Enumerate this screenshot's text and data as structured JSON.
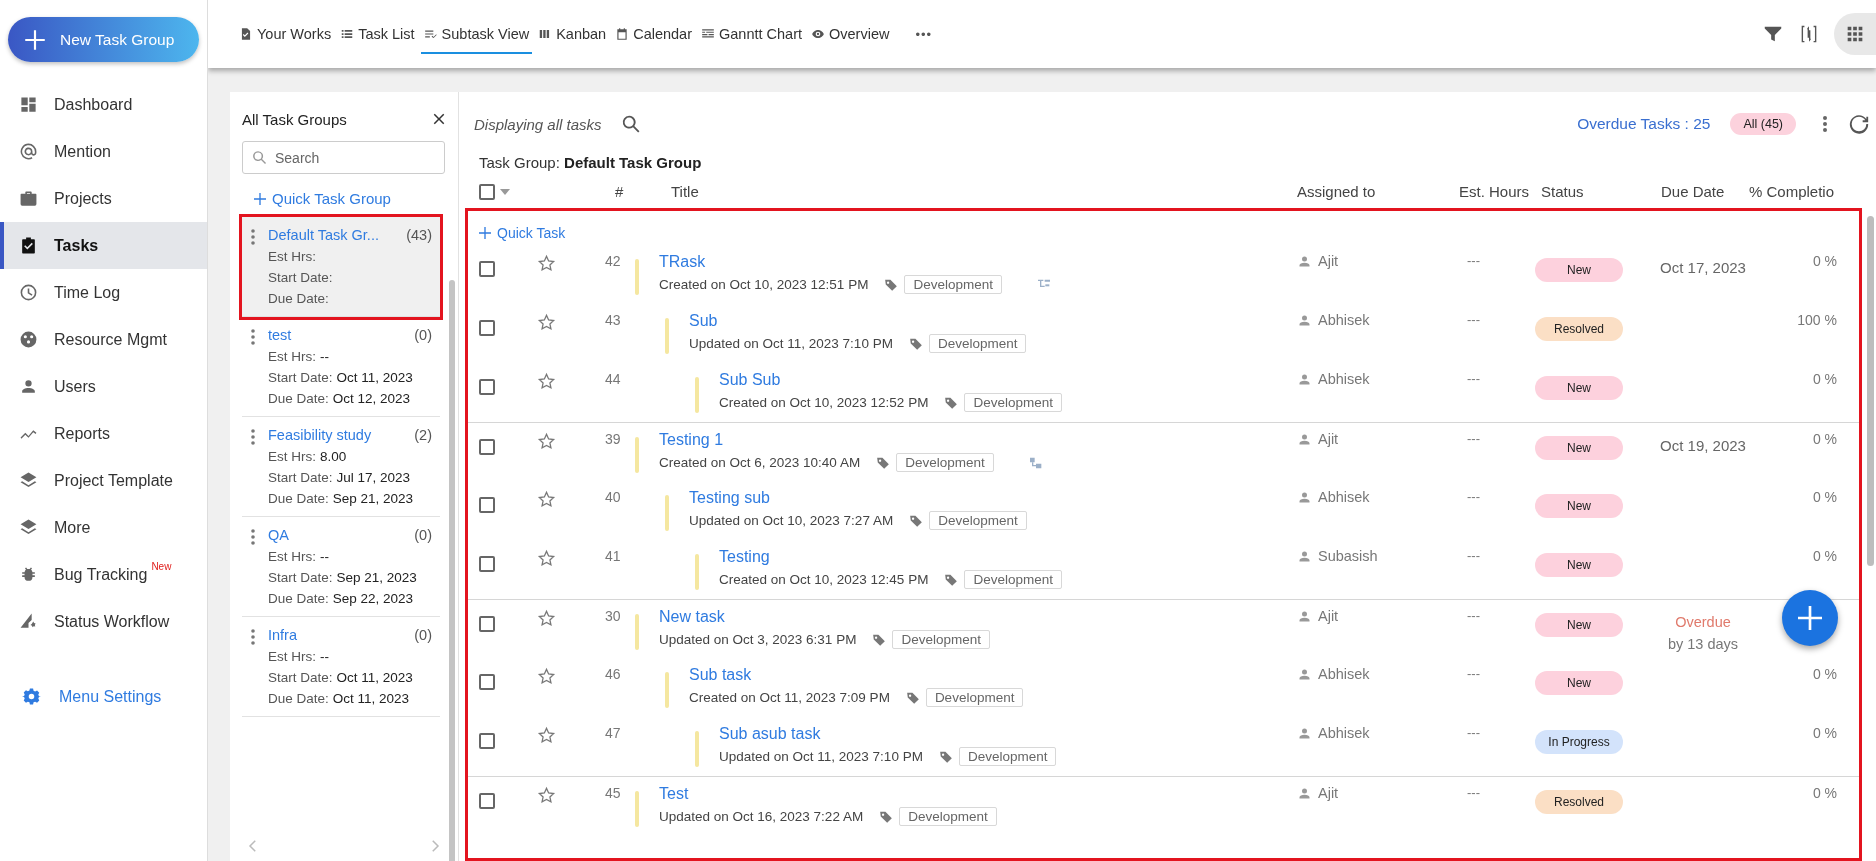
{
  "new_group_button": {
    "label": "New Task Group"
  },
  "nav": [
    {
      "label": "Dashboard",
      "kind": "dashboard",
      "selected": false
    },
    {
      "label": "Mention",
      "kind": "mention",
      "selected": false
    },
    {
      "label": "Projects",
      "kind": "projects",
      "selected": false
    },
    {
      "label": "Tasks",
      "kind": "tasks",
      "selected": true
    },
    {
      "label": "Time Log",
      "kind": "timelog",
      "selected": false
    },
    {
      "label": "Resource Mgmt",
      "kind": "resource",
      "selected": false
    },
    {
      "label": "Users",
      "kind": "users",
      "selected": false
    },
    {
      "label": "Reports",
      "kind": "reports",
      "selected": false
    },
    {
      "label": "Project Template",
      "kind": "template",
      "selected": false
    },
    {
      "label": "More",
      "kind": "more",
      "selected": false
    },
    {
      "label": "Bug Tracking",
      "kind": "bug",
      "selected": false,
      "badge": "New"
    },
    {
      "label": "Status Workflow",
      "kind": "workflow",
      "selected": false
    }
  ],
  "menu_settings": {
    "label": "Menu Settings"
  },
  "tabs": [
    {
      "label": "Your Works",
      "kind": "works",
      "selected": false
    },
    {
      "label": "Task List",
      "kind": "list",
      "selected": false
    },
    {
      "label": "Subtask View",
      "kind": "subtask",
      "selected": true
    },
    {
      "label": "Kanban",
      "kind": "kanban",
      "selected": false
    },
    {
      "label": "Calendar",
      "kind": "calendar",
      "selected": false
    },
    {
      "label": "Ganntt Chart",
      "kind": "gantt",
      "selected": false
    },
    {
      "label": "Overview",
      "kind": "overview",
      "selected": false
    }
  ],
  "more_tabs": "•••",
  "group_panel": {
    "title": "All Task Groups",
    "search_placeholder": "Search",
    "quick_group": "Quick Task Group",
    "groups": [
      {
        "name": "Default Task Gr...",
        "count": "(43)",
        "selected": true,
        "highlighted": true,
        "fields": [
          {
            "label": "Est Hrs:"
          },
          {
            "label": "Start Date:"
          },
          {
            "label": "Due Date:"
          }
        ]
      },
      {
        "name": "test",
        "count": "(0)",
        "selected": false,
        "highlighted": false,
        "fields": [
          {
            "label": "Est Hrs:",
            "value": "--"
          },
          {
            "label": "Start Date:",
            "value": "Oct 11, 2023"
          },
          {
            "label": "Due Date:",
            "value": "Oct 12, 2023"
          }
        ]
      },
      {
        "name": "Feasibility study",
        "count": "(2)",
        "selected": false,
        "highlighted": false,
        "fields": [
          {
            "label": "Est Hrs:",
            "value": "8.00"
          },
          {
            "label": "Start Date:",
            "value": "Jul 17, 2023"
          },
          {
            "label": "Due Date:",
            "value": "Sep 21, 2023"
          }
        ]
      },
      {
        "name": "QA",
        "count": "(0)",
        "selected": false,
        "highlighted": false,
        "fields": [
          {
            "label": "Est Hrs:",
            "value": "--"
          },
          {
            "label": "Start Date:",
            "value": "Sep 21, 2023"
          },
          {
            "label": "Due Date:",
            "value": "Sep 22, 2023"
          }
        ]
      },
      {
        "name": "Infra",
        "count": "(0)",
        "selected": false,
        "highlighted": false,
        "fields": [
          {
            "label": "Est Hrs:",
            "value": "--"
          },
          {
            "label": "Start Date:",
            "value": "Oct 11, 2023"
          },
          {
            "label": "Due Date:",
            "value": "Oct 11, 2023"
          }
        ]
      }
    ]
  },
  "main": {
    "display_label": "Displaying all tasks",
    "overdue_link": "Overdue Tasks : 25",
    "filter_chip": "All (45)",
    "group_label": "Task Group:",
    "group_name": "Default Task Group",
    "select_all": {
      "checked": false
    },
    "columns": [
      "#",
      "Title",
      "Assigned to",
      "Est. Hours",
      "Status",
      "Due Date",
      "% Completio"
    ],
    "highlighted": true,
    "quick_task": "Quick Task",
    "tasks": [
      {
        "number": "42",
        "title": "TRask",
        "meta": "Created on Oct 10, 2023 12:51 PM",
        "tag": "Development",
        "link_icon": {
          "kind": "branch"
        },
        "assignee": "Ajit",
        "est_hours": "---",
        "status": {
          "label": "New",
          "color": "#fdd1dd"
        },
        "due_date": "Oct 17, 2023",
        "completion": "0 %",
        "checked": false,
        "starred": false,
        "children": [
          {
            "number": "43",
            "title": "Sub",
            "meta": "Updated on Oct 11, 2023 7:10 PM",
            "tag": "Development",
            "assignee": "Abhisek",
            "est_hours": "---",
            "status": {
              "label": "Resolved",
              "color": "#fbdfc5"
            },
            "completion": "100 %",
            "checked": false,
            "starred": false,
            "children": [
              {
                "number": "44",
                "title": "Sub Sub",
                "meta": "Created on Oct 10, 2023 12:52 PM",
                "tag": "Development",
                "assignee": "Abhisek",
                "est_hours": "---",
                "status": {
                  "label": "New",
                  "color": "#fdd1dd"
                },
                "completion": "0 %",
                "checked": false,
                "starred": false
              }
            ]
          }
        ]
      },
      {
        "number": "39",
        "title": "Testing 1",
        "meta": "Created on Oct 6, 2023 10:40 AM",
        "tag": "Development",
        "link_icon": {
          "kind": "steps"
        },
        "assignee": "Ajit",
        "est_hours": "---",
        "status": {
          "label": "New",
          "color": "#fdd1dd"
        },
        "due_date": "Oct 19, 2023",
        "completion": "0 %",
        "checked": false,
        "starred": false,
        "children": [
          {
            "number": "40",
            "title": "Testing sub",
            "meta": "Updated on Oct 10, 2023 7:27 AM",
            "tag": "Development",
            "assignee": "Abhisek",
            "est_hours": "---",
            "status": {
              "label": "New",
              "color": "#fdd1dd"
            },
            "completion": "0 %",
            "checked": false,
            "starred": false,
            "children": [
              {
                "number": "41",
                "title": "Testing",
                "meta": "Created on Oct 10, 2023 12:45 PM",
                "tag": "Development",
                "assignee": "Subasish",
                "est_hours": "---",
                "status": {
                  "label": "New",
                  "color": "#fdd1dd"
                },
                "completion": "0 %",
                "checked": false,
                "starred": false
              }
            ]
          }
        ]
      },
      {
        "number": "30",
        "title": "New task",
        "meta": "Updated on Oct 3, 2023 6:31 PM",
        "tag": "Development",
        "assignee": "Ajit",
        "est_hours": "---",
        "status": {
          "label": "New",
          "color": "#fdd1dd"
        },
        "overdue": {
          "label": "Overdue",
          "note": "by 13 days"
        },
        "checked": false,
        "starred": false,
        "children": [
          {
            "number": "46",
            "title": "Sub task",
            "meta": "Created on Oct 11, 2023 7:09 PM",
            "tag": "Development",
            "assignee": "Abhisek",
            "est_hours": "---",
            "status": {
              "label": "New",
              "color": "#fdd1dd"
            },
            "completion": "0 %",
            "checked": false,
            "starred": false,
            "children": [
              {
                "number": "47",
                "title": "Sub asub task",
                "meta": "Updated on Oct 11, 2023 7:10 PM",
                "tag": "Development",
                "assignee": "Abhisek",
                "est_hours": "---",
                "status": {
                  "label": "In Progress",
                  "color": "#d3e3fb"
                },
                "completion": "0 %",
                "checked": false,
                "starred": false
              }
            ]
          }
        ]
      },
      {
        "number": "45",
        "title": "Test",
        "meta": "Updated on Oct 16, 2023 7:22 AM",
        "tag": "Development",
        "assignee": "Ajit",
        "est_hours": "---",
        "status": {
          "label": "Resolved",
          "color": "#fbdfc5"
        },
        "completion": "0 %",
        "checked": false,
        "starred": false
      }
    ]
  }
}
